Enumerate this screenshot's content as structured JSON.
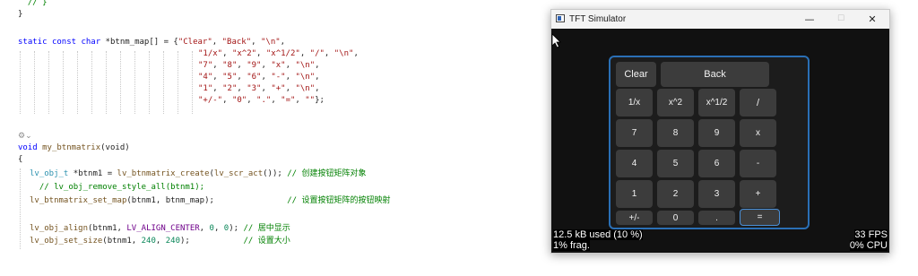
{
  "editor": {
    "line1": "  // }",
    "line2": "}",
    "map": {
      "kw1": "static",
      "kw2": "const",
      "kw3": "char",
      "decl": " *btnm_map[] = {",
      "r1": [
        "\"Clear\"",
        "\"Back\"",
        "\"\\n\""
      ],
      "r2": [
        "\"1/x\"",
        "\"x^2\"",
        "\"x^1/2\"",
        "\"/\"",
        "\"\\n\""
      ],
      "r3": [
        "\"7\"",
        "\"8\"",
        "\"9\"",
        "\"x\"",
        "\"\\n\""
      ],
      "r4": [
        "\"4\"",
        "\"5\"",
        "\"6\"",
        "\"-\"",
        "\"\\n\""
      ],
      "r5": [
        "\"1\"",
        "\"2\"",
        "\"3\"",
        "\"+\"",
        "\"\\n\""
      ],
      "r6": [
        "\"+/-\"",
        "\"0\"",
        "\".\"",
        "\"=\"",
        "\"\""
      ],
      "end": "};"
    },
    "fn_kw": "void",
    "fn_name": "my_btnmatrix",
    "fn_args": "(void)",
    "open_brace": "{",
    "l_create": {
      "type": "lv_obj_t",
      "rest": " *btnm1 = ",
      "fn": "lv_btnmatrix_create",
      "args": "(",
      "fn2": "lv_scr_act",
      "tail": "()); ",
      "cmt": "// 创建按钮矩阵对象"
    },
    "l_remove": "  // lv_obj_remove_style_all(btnm1);",
    "l_setmap": {
      "fn": "lv_btnmatrix_set_map",
      "args": "(btnm1, btnm_map);",
      "pad": "               ",
      "cmt": "// 设置按钮矩阵的按钮映射"
    },
    "l_align": {
      "fn": "lv_obj_align",
      "a1": "(btnm1, ",
      "cn": "LV_ALIGN_CENTER",
      "a2": ", ",
      "n1": "0",
      "a3": ", ",
      "n2": "0",
      "a4": "); ",
      "cmt": "// 居中显示"
    },
    "l_size": {
      "fn": "lv_obj_set_size",
      "a1": "(btnm1, ",
      "n1": "240",
      "a2": ", ",
      "n2": "240",
      "a3": ");",
      "pad": "           ",
      "cmt": "// 设置大小"
    },
    "gutter_glyph": "⚙⌄"
  },
  "window": {
    "title": "TFT Simulator",
    "minimize": "—",
    "maximize": "☐",
    "close": "✕"
  },
  "keypad": {
    "keys": [
      "Clear",
      "Back",
      "1/x",
      "x^2",
      "x^1/2",
      "/",
      "7",
      "8",
      "9",
      "x",
      "4",
      "5",
      "6",
      "-",
      "1",
      "2",
      "3",
      "+",
      "+/-",
      "0",
      ".",
      "="
    ],
    "selected_key": "="
  },
  "status": {
    "mem_used": "12.5 kB used (10 %)",
    "frag": "1% frag.",
    "fps": "33 FPS",
    "cpu": "0% CPU"
  },
  "colors": {
    "accent": "#2a6fb5",
    "button": "#3c3c3c",
    "screen": "#111111"
  }
}
